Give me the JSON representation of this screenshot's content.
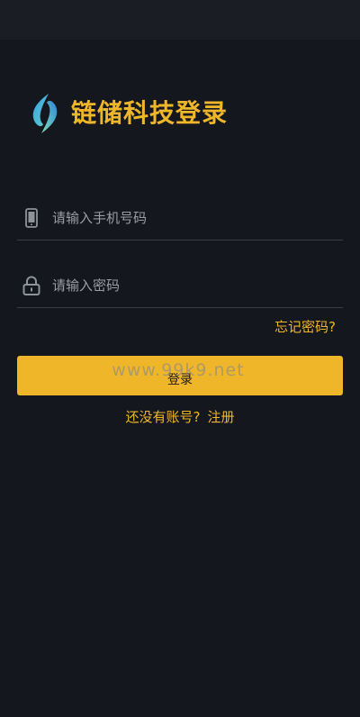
{
  "header": {
    "title": "链储科技登录",
    "logo_icon": "brand-leaf-logo-icon"
  },
  "form": {
    "phone": {
      "placeholder": "请输入手机号码",
      "value": "",
      "icon": "phone-icon"
    },
    "password": {
      "placeholder": "请输入密码",
      "value": "",
      "icon": "lock-icon"
    },
    "forgot_label": "忘记密码?",
    "login_label": "登录"
  },
  "footer": {
    "prompt": "还没有账号?",
    "register_label": "注册"
  },
  "watermark": "www.99k9.net",
  "colors": {
    "background": "#15171e",
    "accent": "#f0b62a",
    "divider": "#3a3d46",
    "placeholder": "#9a9da6"
  }
}
